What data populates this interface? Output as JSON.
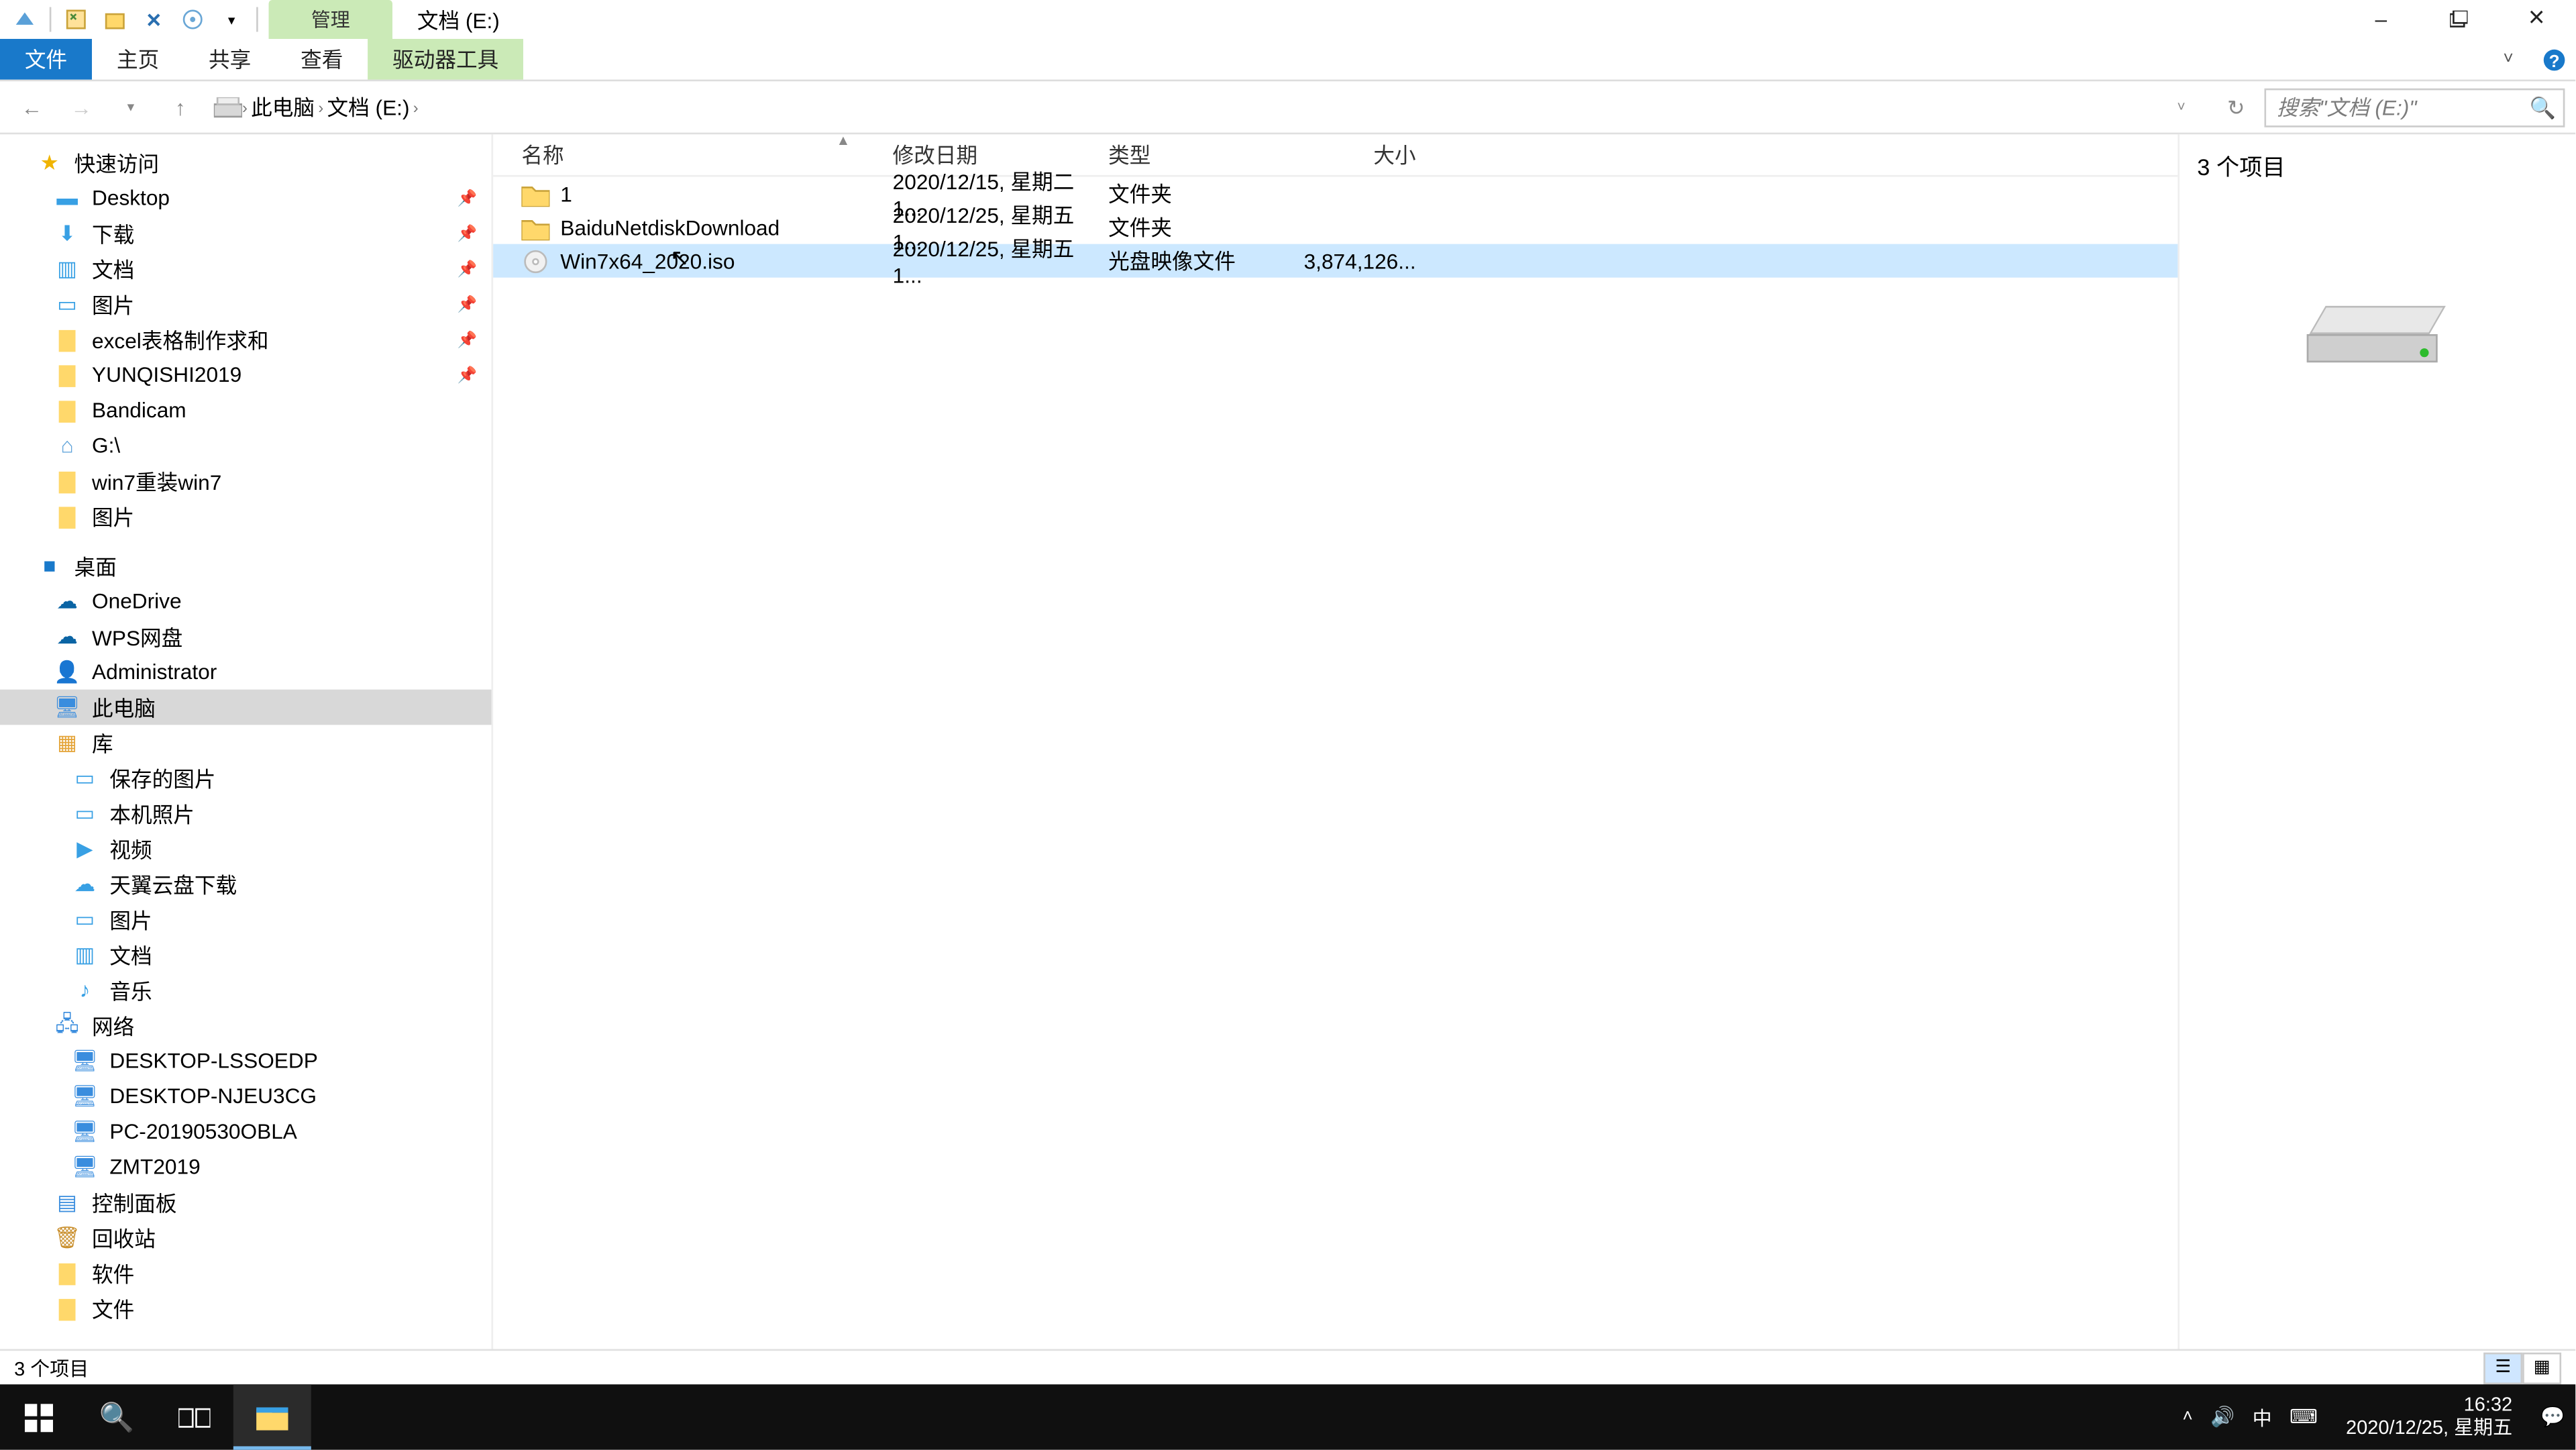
{
  "window_controls": {
    "minimize": "–",
    "maximize": "□",
    "close": "×"
  },
  "ribbon_context_tab": "管理",
  "window_title": "文档 (E:)",
  "ribbon_tabs": {
    "file": "文件",
    "home": "主页",
    "share": "共享",
    "view": "查看",
    "drive": "驱动器工具"
  },
  "breadcrumb": {
    "pc": "此电脑",
    "drive": "文档 (E:)"
  },
  "search_placeholder": "搜索\"文档 (E:)\"",
  "columns": {
    "name": "名称",
    "date": "修改日期",
    "type": "类型",
    "size": "大小"
  },
  "files": [
    {
      "name": "1",
      "date": "2020/12/15, 星期二 1...",
      "type": "文件夹",
      "size": ""
    },
    {
      "name": "BaiduNetdiskDownload",
      "date": "2020/12/25, 星期五 1...",
      "type": "文件夹",
      "size": ""
    },
    {
      "name": "Win7x64_2020.iso",
      "date": "2020/12/25, 星期五 1...",
      "type": "光盘映像文件",
      "size": "3,874,126..."
    }
  ],
  "preview_title": "3 个项目",
  "status_text": "3 个项目",
  "tree": {
    "quick_access": "快速访问",
    "qa_items": [
      "Desktop",
      "下载",
      "文档",
      "图片",
      "excel表格制作求和",
      "YUNQISHI2019",
      "Bandicam",
      "G:\\",
      "win7重装win7",
      "图片"
    ],
    "desktop": "桌面",
    "desktop_items": [
      "OneDrive",
      "WPS网盘",
      "Administrator",
      "此电脑",
      "库"
    ],
    "lib_items": [
      "保存的图片",
      "本机照片",
      "视频",
      "天翼云盘下载",
      "图片",
      "文档",
      "音乐"
    ],
    "network": "网络",
    "net_items": [
      "DESKTOP-LSSOEDP",
      "DESKTOP-NJEU3CG",
      "PC-20190530OBLA",
      "ZMT2019"
    ],
    "control_panel": "控制面板",
    "recycle": "回收站",
    "software": "软件",
    "files_folder": "文件"
  },
  "tray": {
    "time": "16:32",
    "date": "2020/12/25, 星期五",
    "ime": "中"
  }
}
